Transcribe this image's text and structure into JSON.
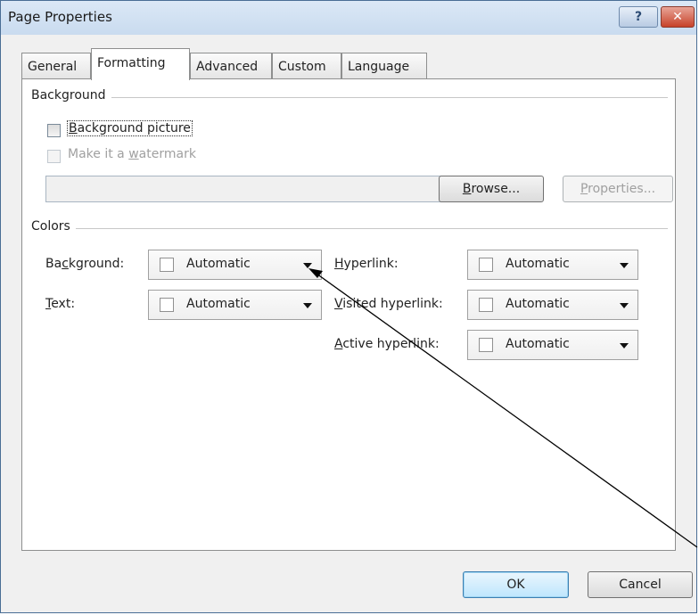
{
  "window": {
    "title": "Page Properties"
  },
  "titlebar": {
    "help_glyph": "?",
    "close_glyph": "✕"
  },
  "tabs": [
    {
      "label": "General"
    },
    {
      "label": "Formatting"
    },
    {
      "label": "Advanced"
    },
    {
      "label": "Custom"
    },
    {
      "label": "Language"
    }
  ],
  "background_group": {
    "label": "Background",
    "bg_picture": {
      "pre": "",
      "key": "B",
      "post": "ackground picture"
    },
    "watermark": {
      "pre": "Make it a ",
      "key": "w",
      "post": "atermark"
    },
    "path_value": "",
    "browse": {
      "pre": "",
      "key": "B",
      "post": "rowse..."
    },
    "properties": {
      "pre": "",
      "key": "P",
      "post": "roperties..."
    }
  },
  "colors_group": {
    "label": "Colors",
    "background": {
      "pre": "Ba",
      "key": "c",
      "post": "kground:",
      "value": "Automatic"
    },
    "text": {
      "pre": "",
      "key": "T",
      "post": "ext:",
      "value": "Automatic"
    },
    "hyperlink": {
      "pre": "",
      "key": "H",
      "post": "yperlink:",
      "value": "Automatic"
    },
    "visited": {
      "pre": "",
      "key": "V",
      "post": "isited hyperlink:",
      "value": "Automatic"
    },
    "active": {
      "pre": "",
      "key": "A",
      "post": "ctive hyperlink:",
      "value": "Automatic"
    }
  },
  "footer": {
    "ok": "OK",
    "cancel": "Cancel"
  },
  "annotation": {
    "color": "#000000"
  }
}
